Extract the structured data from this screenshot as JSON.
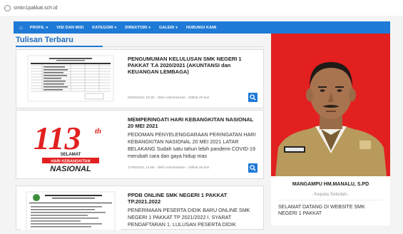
{
  "browser": {
    "url": "smkn1pakkat.sch.id"
  },
  "nav": {
    "home_icon": "home-icon",
    "items": [
      {
        "label": "PROFIL",
        "caret": "▾"
      },
      {
        "label": "VISI DAN MISI",
        "caret": ""
      },
      {
        "label": "KATEGORI",
        "caret": "▾"
      },
      {
        "label": "DIREKTORI",
        "caret": "▾"
      },
      {
        "label": "GALERI",
        "caret": "▾"
      },
      {
        "label": "HUBUNGI KAMI",
        "caret": ""
      }
    ]
  },
  "main": {
    "section_title": "Tulisan Terbaru",
    "posts": [
      {
        "title": "PENGUMUMAN KELULUSAN SMK NEGERI 1 PAKKAT T.A 2020/2021 (AKUNTANSI dan KEUANGAN LEMBAGA)",
        "excerpt": "",
        "meta": "03/06/2021 18:36 - Oleh Administrator - Dilihat 26 kali"
      },
      {
        "title": "MEMPERINGATI HARI KEBANGKITAN NASIONAL 20 MEI 2021",
        "excerpt": "PEDOMAN PENYELENGGARAAN PERINGATAN HARI KEBANGKITAN NASIONAL 20 MEI 2021 LATAR BELAKANG Sudah satu tahun lebih pandemi COVID-19 merubah cara dan gaya hidup mas",
        "meta": "17/05/2021 14:59 - Oleh Administrator - Dilihat 45 kali",
        "thumb": {
          "number": "113",
          "sup": "th",
          "line1": "SELAMAT",
          "line2": "HARI KEBANGKITAN",
          "line3": "NASIONAL"
        }
      },
      {
        "title": "PPDB ONLINE SMK NEGERI 1 PAKKAT TP.2021.2022",
        "excerpt": "PENERIMAAN PESERTA DIDIK BARU ONLINE SMK NEGERI 1 PAKKAT TP 2021/2022 I. SYARAT PENDAFTARAN 1. LULUSAN PESERTA DIDIK",
        "meta": ""
      }
    ]
  },
  "sidebar": {
    "name": "MANGAMPU HM.MANALU, S.PD",
    "role": "- Kepala Sekolah -",
    "welcome": "SELAMAT DATANG DI WEBSITE SMK NEGERI 1 PAKKAT"
  },
  "colors": {
    "nav": "#1e7ad6",
    "accent": "#e22020",
    "title": "#1e6fc2"
  }
}
